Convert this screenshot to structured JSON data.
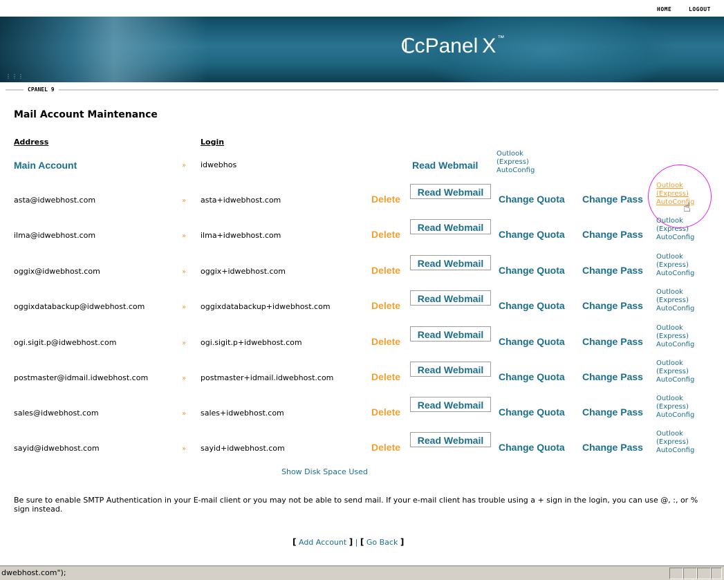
{
  "topnav": {
    "home": "HOME",
    "logout": "LOGOUT"
  },
  "banner": {
    "logo_text": "cPanel",
    "logo_x": "X",
    "logo_tm": "™"
  },
  "tabbar": {
    "label": "CPANEL 9"
  },
  "page": {
    "title": "Mail Account Maintenance"
  },
  "columns": {
    "address": "Address",
    "login": "Login"
  },
  "main_account": {
    "label": "Main Account",
    "login": "idwebhos",
    "webmail": "Read Webmail",
    "outlook_1": "Outlook",
    "outlook_2": "(Express)",
    "outlook_3": "AutoConfig"
  },
  "actions": {
    "delete": "Delete",
    "webmail": "Read Webmail",
    "quota": "Change Quota",
    "pass": "Change Pass",
    "outlook_1": "Outlook",
    "outlook_2": "(Express)",
    "outlook_3": "AutoConfig"
  },
  "accounts": [
    {
      "address": "asta@idwebhost.com",
      "login": "asta+idwebhost.com"
    },
    {
      "address": "ilma@idwebhost.com",
      "login": "ilma+idwebhost.com"
    },
    {
      "address": "oggix@idwebhost.com",
      "login": "oggix+idwebhost.com"
    },
    {
      "address": "oggixdatabackup@idwebhost.com",
      "login": "oggixdatabackup+idwebhost.com"
    },
    {
      "address": "ogi.sigit.p@idwebhost.com",
      "login": "ogi.sigit.p+idwebhost.com"
    },
    {
      "address": "postmaster@idmail.idwebhost.com",
      "login": "postmaster+idmail.idwebhost.com"
    },
    {
      "address": "sales@idwebhost.com",
      "login": "sales+idwebhost.com"
    },
    {
      "address": "sayid@idwebhost.com",
      "login": "sayid+idwebhost.com"
    }
  ],
  "disk_link": "Show Disk Space Used",
  "note": "Be sure to enable SMTP Authentication in your E-mail client or you may not be able to send mail. If your e-mail client has trouble using a + sign in the login, you can use @, :, or % sign instead.",
  "bottom_links": {
    "add": "Add Account",
    "back": "Go Back"
  },
  "statusbar": {
    "text": "dwebhost.com\");"
  },
  "colors": {
    "accent": "#1c6f8c",
    "delete": "#f0a030",
    "highlight_circle": "#e81ee8"
  }
}
